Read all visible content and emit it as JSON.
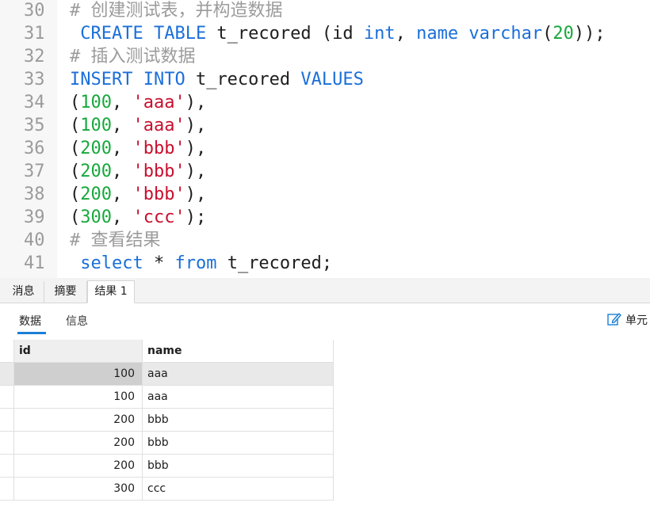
{
  "editor": {
    "lines": [
      {
        "num": "30",
        "tokens": [
          {
            "t": "# 创建测试表，并构造数据",
            "c": "c"
          }
        ]
      },
      {
        "num": "31",
        "tokens": [
          {
            "t": " CREATE TABLE",
            "c": "k"
          },
          {
            "t": " t_recored (id ",
            "c": "p"
          },
          {
            "t": "int",
            "c": "k"
          },
          {
            "t": ", ",
            "c": "p"
          },
          {
            "t": "name varchar",
            "c": "k"
          },
          {
            "t": "(",
            "c": "p"
          },
          {
            "t": "20",
            "c": "n"
          },
          {
            "t": "));",
            "c": "p"
          }
        ]
      },
      {
        "num": "32",
        "tokens": [
          {
            "t": "# 插入测试数据",
            "c": "c"
          }
        ]
      },
      {
        "num": "33",
        "tokens": [
          {
            "t": "INSERT INTO",
            "c": "k"
          },
          {
            "t": " t_recored ",
            "c": "p"
          },
          {
            "t": "VALUES",
            "c": "k"
          }
        ]
      },
      {
        "num": "34",
        "tokens": [
          {
            "t": "(",
            "c": "p"
          },
          {
            "t": "100",
            "c": "n"
          },
          {
            "t": ", ",
            "c": "p"
          },
          {
            "t": "'aaa'",
            "c": "s"
          },
          {
            "t": "),",
            "c": "p"
          }
        ]
      },
      {
        "num": "35",
        "tokens": [
          {
            "t": "(",
            "c": "p"
          },
          {
            "t": "100",
            "c": "n"
          },
          {
            "t": ", ",
            "c": "p"
          },
          {
            "t": "'aaa'",
            "c": "s"
          },
          {
            "t": "),",
            "c": "p"
          }
        ]
      },
      {
        "num": "36",
        "tokens": [
          {
            "t": "(",
            "c": "p"
          },
          {
            "t": "200",
            "c": "n"
          },
          {
            "t": ", ",
            "c": "p"
          },
          {
            "t": "'bbb'",
            "c": "s"
          },
          {
            "t": "),",
            "c": "p"
          }
        ]
      },
      {
        "num": "37",
        "tokens": [
          {
            "t": "(",
            "c": "p"
          },
          {
            "t": "200",
            "c": "n"
          },
          {
            "t": ", ",
            "c": "p"
          },
          {
            "t": "'bbb'",
            "c": "s"
          },
          {
            "t": "),",
            "c": "p"
          }
        ]
      },
      {
        "num": "38",
        "tokens": [
          {
            "t": "(",
            "c": "p"
          },
          {
            "t": "200",
            "c": "n"
          },
          {
            "t": ", ",
            "c": "p"
          },
          {
            "t": "'bbb'",
            "c": "s"
          },
          {
            "t": "),",
            "c": "p"
          }
        ]
      },
      {
        "num": "39",
        "tokens": [
          {
            "t": "(",
            "c": "p"
          },
          {
            "t": "300",
            "c": "n"
          },
          {
            "t": ", ",
            "c": "p"
          },
          {
            "t": "'ccc'",
            "c": "s"
          },
          {
            "t": ");",
            "c": "p"
          }
        ]
      },
      {
        "num": "40",
        "tokens": [
          {
            "t": "# 查看结果",
            "c": "c"
          }
        ]
      },
      {
        "num": "41",
        "tokens": [
          {
            "t": " select",
            "c": "k"
          },
          {
            "t": " * ",
            "c": "p"
          },
          {
            "t": "from",
            "c": "k"
          },
          {
            "t": " t_recored;",
            "c": "p"
          }
        ]
      }
    ]
  },
  "result_tabs": {
    "messages_label": "消息",
    "summary_label": "摘要",
    "result_label": "结果 1"
  },
  "sub_tabs": {
    "data_label": "数据",
    "info_label": "信息",
    "cell_edit_label": "单元"
  },
  "grid": {
    "columns": [
      "id",
      "name"
    ],
    "rows": [
      {
        "id": "100",
        "name": "aaa"
      },
      {
        "id": "100",
        "name": "aaa"
      },
      {
        "id": "200",
        "name": "bbb"
      },
      {
        "id": "200",
        "name": "bbb"
      },
      {
        "id": "200",
        "name": "bbb"
      },
      {
        "id": "300",
        "name": "ccc"
      }
    ],
    "selected_row": 0
  },
  "colors": {
    "keyword": "#1a6fd9",
    "number": "#17a83c",
    "string": "#c8102e",
    "comment": "#9b9b9b",
    "accent": "#1a7fd6"
  }
}
